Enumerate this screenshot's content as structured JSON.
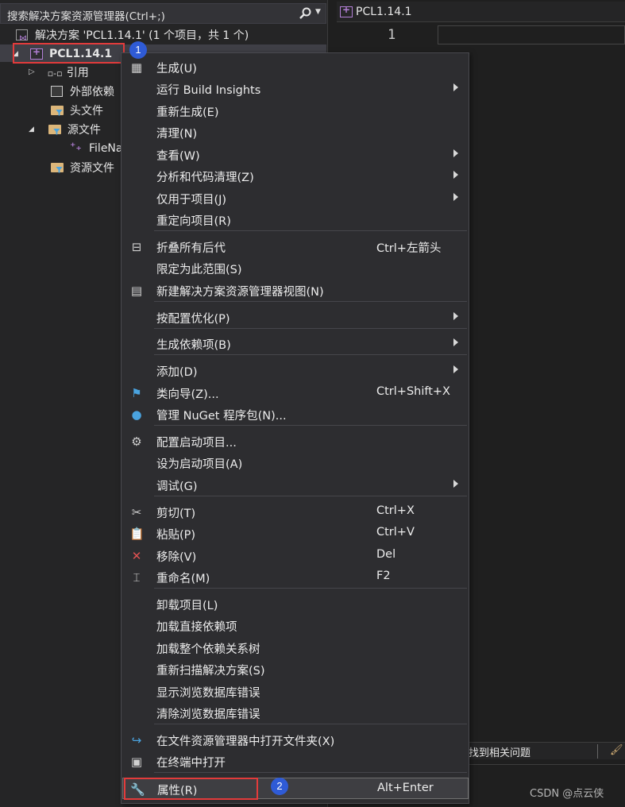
{
  "search": {
    "placeholder": "搜索解决方案资源管理器(Ctrl+;)"
  },
  "tree": {
    "solution": "解决方案 'PCL1.14.1' (1 个项目，共 1 个)",
    "project": "PCL1.14.1",
    "references": "引用",
    "external": "外部依赖",
    "headers": "头文件",
    "sources": "源文件",
    "file": "FileNa",
    "resources": "资源文件"
  },
  "editor": {
    "tab": "PCL1.14.1",
    "line": "1"
  },
  "menu": {
    "items": [
      {
        "label": "生成(U)",
        "shortcut": "",
        "icon": "build-icon"
      },
      {
        "label": "运行 Build Insights",
        "shortcut": "",
        "icon": ""
      },
      {
        "label": "重新生成(E)",
        "shortcut": "",
        "icon": ""
      },
      {
        "label": "清理(N)",
        "shortcut": "",
        "icon": ""
      },
      {
        "label": "查看(W)",
        "shortcut": "",
        "icon": ""
      },
      {
        "label": "分析和代码清理(Z)",
        "shortcut": "",
        "icon": ""
      },
      {
        "label": "仅用于项目(J)",
        "shortcut": "",
        "icon": ""
      },
      {
        "label": "重定向项目(R)",
        "shortcut": "",
        "icon": ""
      },
      {
        "label": "折叠所有后代",
        "shortcut": "Ctrl+左箭头",
        "icon": "collapse-icon"
      },
      {
        "label": "限定为此范围(S)",
        "shortcut": "",
        "icon": ""
      },
      {
        "label": "新建解决方案资源管理器视图(N)",
        "shortcut": "",
        "icon": "new-view-icon"
      },
      {
        "label": "按配置优化(P)",
        "shortcut": "",
        "icon": ""
      },
      {
        "label": "生成依赖项(B)",
        "shortcut": "",
        "icon": ""
      },
      {
        "label": "添加(D)",
        "shortcut": "",
        "icon": ""
      },
      {
        "label": "类向导(Z)...",
        "shortcut": "Ctrl+Shift+X",
        "icon": "class-wizard-icon"
      },
      {
        "label": "管理 NuGet 程序包(N)...",
        "shortcut": "",
        "icon": "nuget-icon"
      },
      {
        "label": "配置启动项目...",
        "shortcut": "",
        "icon": "gear-icon"
      },
      {
        "label": "设为启动项目(A)",
        "shortcut": "",
        "icon": ""
      },
      {
        "label": "调试(G)",
        "shortcut": "",
        "icon": ""
      },
      {
        "label": "剪切(T)",
        "shortcut": "Ctrl+X",
        "icon": "scissors-icon"
      },
      {
        "label": "粘贴(P)",
        "shortcut": "Ctrl+V",
        "icon": "paste-icon"
      },
      {
        "label": "移除(V)",
        "shortcut": "Del",
        "icon": "remove-icon"
      },
      {
        "label": "重命名(M)",
        "shortcut": "F2",
        "icon": "rename-icon"
      },
      {
        "label": "卸载项目(L)",
        "shortcut": "",
        "icon": ""
      },
      {
        "label": "加载直接依赖项",
        "shortcut": "",
        "icon": ""
      },
      {
        "label": "加载整个依赖关系树",
        "shortcut": "",
        "icon": ""
      },
      {
        "label": "重新扫描解决方案(S)",
        "shortcut": "",
        "icon": ""
      },
      {
        "label": "显示浏览数据库错误",
        "shortcut": "",
        "icon": ""
      },
      {
        "label": "清除浏览数据库错误",
        "shortcut": "",
        "icon": ""
      },
      {
        "label": "在文件资源管理器中打开文件夹(X)",
        "shortcut": "",
        "icon": "open-folder-icon"
      },
      {
        "label": "在终端中打开",
        "shortcut": "",
        "icon": "terminal-icon"
      },
      {
        "label": "属性(R)",
        "shortcut": "Alt+Enter",
        "icon": "wrench-icon"
      }
    ]
  },
  "badges": {
    "one": "1",
    "two": "2"
  },
  "bottom": {
    "issues": "找到相关问题",
    "watermark": "CSDN @点云侠"
  }
}
